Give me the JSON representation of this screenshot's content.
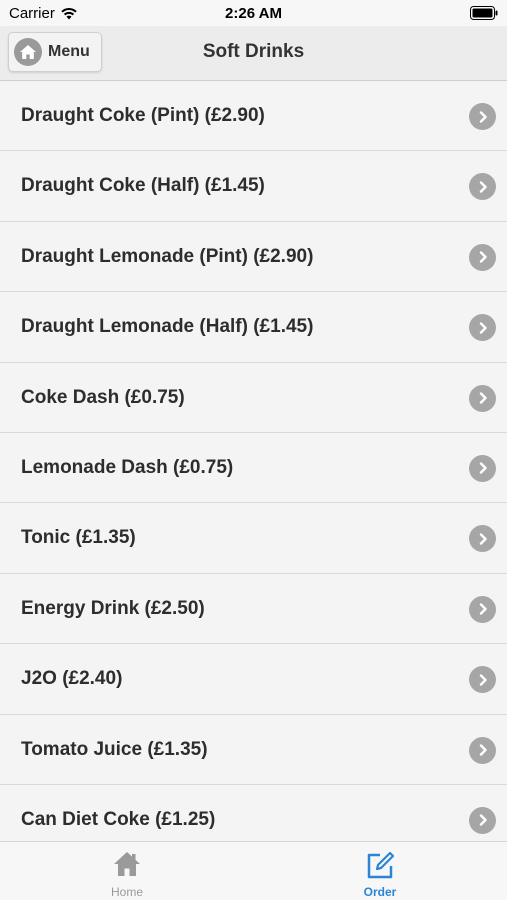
{
  "status_bar": {
    "carrier": "Carrier",
    "time": "2:26 AM"
  },
  "nav": {
    "menu_label": "Menu",
    "title": "Soft Drinks"
  },
  "items": [
    "Draught Coke (Pint) (£2.90)",
    "Draught Coke (Half) (£1.45)",
    "Draught Lemonade (Pint) (£2.90)",
    "Draught Lemonade (Half) (£1.45)",
    "Coke Dash (£0.75)",
    "Lemonade Dash (£0.75)",
    "Tonic (£1.35)",
    "Energy Drink (£2.50)",
    "J2O (£2.40)",
    "Tomato Juice (£1.35)",
    "Can Diet Coke (£1.25)"
  ],
  "tabs": {
    "home_label": "Home",
    "order_label": "Order"
  },
  "colors": {
    "accent": "#2c84d6",
    "icon_gray": "#9a9a9a"
  }
}
